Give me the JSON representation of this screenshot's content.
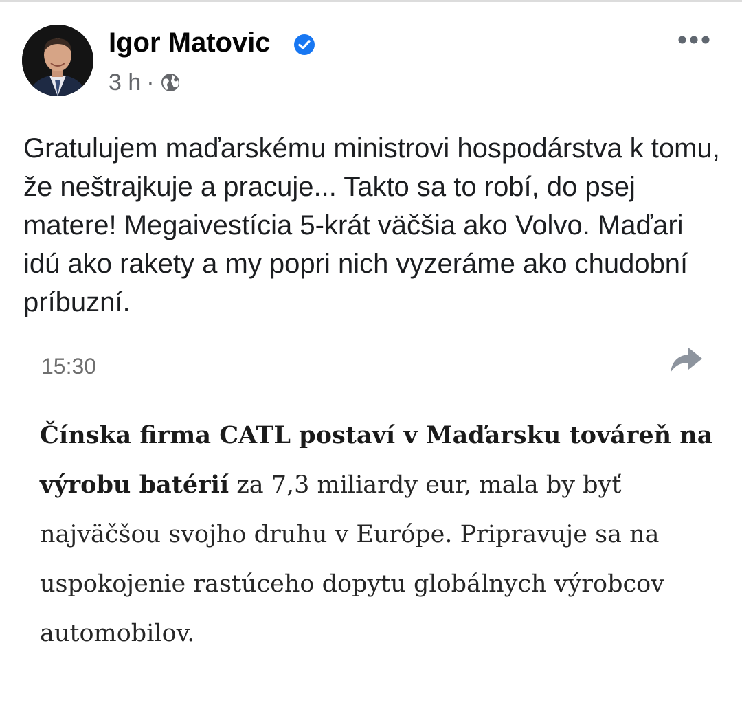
{
  "post": {
    "author": "Igor Matovic",
    "timestamp": "3 h",
    "separator": "·",
    "text": "Gratulujem maďarskému ministrovi hospodárstva k tomu, že neštrajkuje a pracuje... Takto sa to robí, do psej matere! Megaivestícia 5-krát väčšia ako Volvo. Maďari idú ako rakety a my popri nich vyzeráme ako chudobní príbuzní."
  },
  "embed": {
    "time": "15:30",
    "headline_bold": "Čínska firma CATL postaví v Maďarsku továreň na výrobu batérií",
    "headline_rest": " za 7,3 miliardy eur, mala by byť najväčšou svojho druhu v Európe. Pripravuje sa na uspokojenie rastúceho dopytu globálnych výrobcov automobilov."
  },
  "icons": {
    "verified": "verified-badge-icon",
    "globe": "globe-icon",
    "more": "more-options-icon",
    "share": "share-arrow-icon"
  },
  "colors": {
    "verified": "#1877f2",
    "secondary_text": "#65676b",
    "primary_text": "#050505"
  }
}
